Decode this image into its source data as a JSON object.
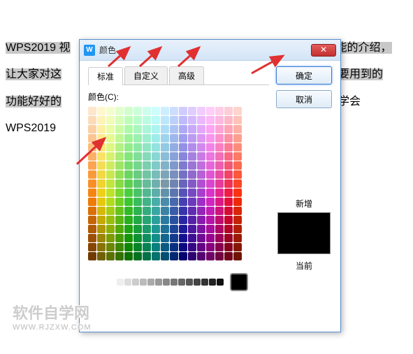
{
  "background": {
    "line1a": "WPS2019 视",
    "line1b": "能的介绍，",
    "line2a": "让大家对这",
    "line2b": "中要用到的",
    "line3a": "功能好好的",
    "line3b": "的学会",
    "line4": "WPS2019"
  },
  "dialog": {
    "title": "颜色",
    "app_icon": "W",
    "close": "✕",
    "tabs": {
      "standard": "标准",
      "custom": "自定义",
      "advanced": "高级"
    },
    "color_label": "颜色(C):",
    "buttons": {
      "ok": "确定",
      "cancel": "取消"
    },
    "preview": {
      "new": "新增",
      "current": "当前",
      "color": "#000000"
    }
  },
  "watermark": {
    "main": "软件自学网",
    "sub": "WWW.RJZXW.COM"
  },
  "grayscale": [
    "#ffffff",
    "#eeeeee",
    "#dddddd",
    "#cccccc",
    "#bbbbbb",
    "#aaaaaa",
    "#999999",
    "#888888",
    "#777777",
    "#666666",
    "#555555",
    "#444444",
    "#333333",
    "#222222",
    "#111111"
  ]
}
